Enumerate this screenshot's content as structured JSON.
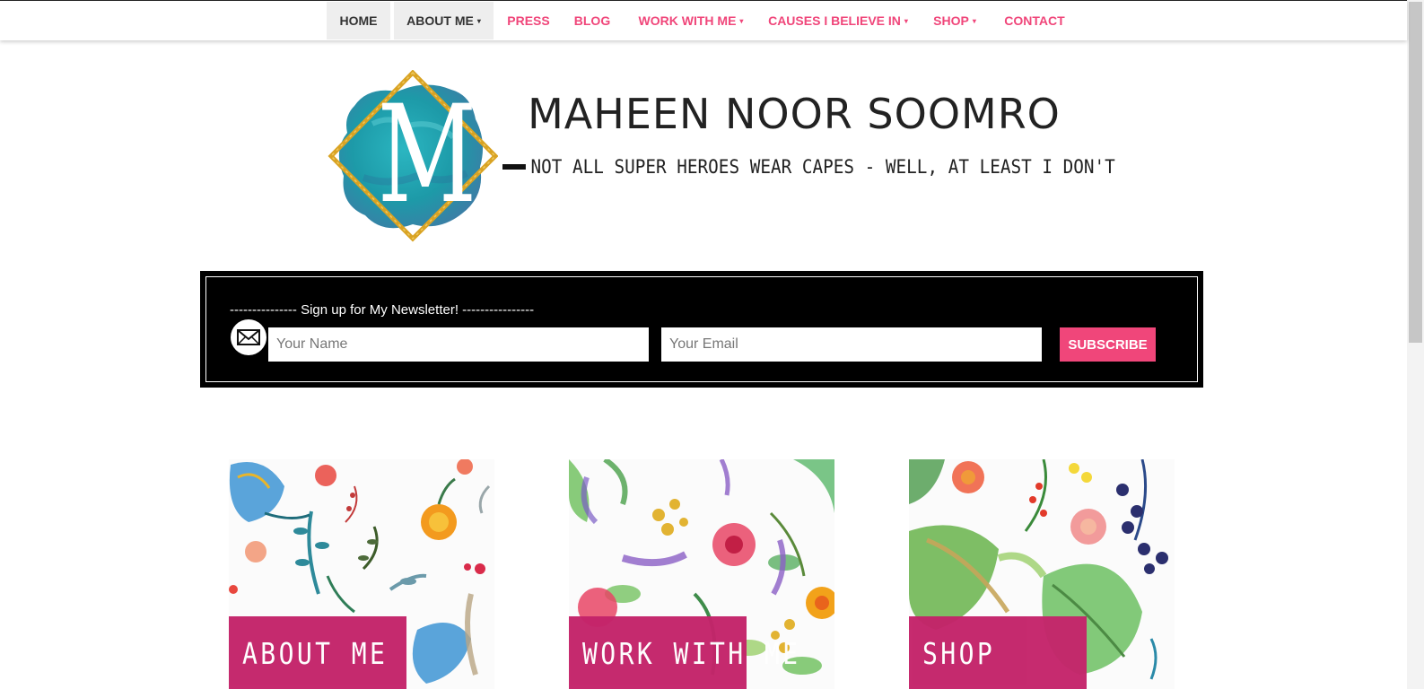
{
  "nav": {
    "items": [
      {
        "label": "HOME",
        "has_caret": false
      },
      {
        "label": "ABOUT ME",
        "has_caret": true
      },
      {
        "label": "PRESS",
        "has_caret": false
      },
      {
        "label": "BLOG",
        "has_caret": false
      },
      {
        "label": "WORK WITH ME",
        "has_caret": true
      },
      {
        "label": "CAUSES I BELIEVE IN",
        "has_caret": true
      },
      {
        "label": "SHOP",
        "has_caret": true
      },
      {
        "label": "CONTACT",
        "has_caret": false
      }
    ],
    "caret": "▾"
  },
  "header": {
    "logo_letter": "M",
    "title": "MAHEEN NOOR SOOMRO",
    "tagline": "NOT ALL SUPER HEROES WEAR CAPES - WELL, AT LEAST I DON'T"
  },
  "newsletter": {
    "heading": "--------------- Sign up for My Newsletter! ----------------",
    "name_placeholder": "Your Name",
    "email_placeholder": "Your Email",
    "subscribe_label": "SUBSCRIBE",
    "icon": "envelope-icon"
  },
  "cards": [
    {
      "label": "ABOUT ME"
    },
    {
      "label": "WORK WITH ME"
    },
    {
      "label": "SHOP"
    }
  ],
  "colors": {
    "accent_pink": "#f0467a",
    "card_label_magenta": "#c4246a",
    "newsletter_bg": "#000000",
    "logo_teal": "#1fa7b5",
    "logo_gold": "#d9a323"
  }
}
